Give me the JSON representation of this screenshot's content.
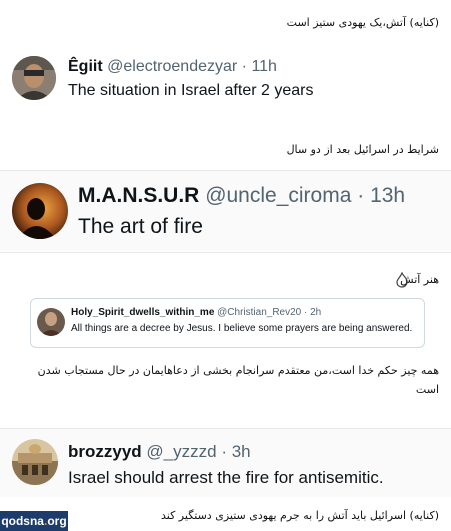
{
  "captions": {
    "c1": "(کنایه) آتش،یک یهودی ستیز است",
    "c2": "شرایط در اسرائیل بعد از دو سال",
    "c3": "هنر آتش",
    "c4": "همه چیز حکم خدا است،من معتقدم سرانجام بخشی از دعاهایمان در حال مستجاب شدن است",
    "c5": "(کنایه) اسرائیل باید آتش را به جرم یهودی ستیزی دستگیر کند"
  },
  "tweets": [
    {
      "name": "Êgiit",
      "handle": "@electroendezyar",
      "time": "· 11h",
      "text": "The situation in Israel after 2 years"
    },
    {
      "name": "M.A.N.S.U.R",
      "handle": "@uncle_ciroma",
      "time": "· 13h",
      "text": "The art of fire"
    },
    {
      "name": "brozzyyd",
      "handle": "@_yzzzd",
      "time": "· 3h",
      "text": "Israel should arrest the fire for antisemitic."
    }
  ],
  "quote": {
    "name": "Holy_Spirit_dwells_within_me",
    "handle": "@Christian_Rev20",
    "time": "· 2h",
    "text": "All things are a decree by Jesus. I believe some prayers are being answered."
  },
  "watermark": {
    "logo_text": "qodsna",
    "logo_dot": ".",
    "logo_tld": "org"
  },
  "colors": {
    "name": "#0f1419",
    "meta": "#536471",
    "logo_bg": "#1d3b6b",
    "logo_accent": "#ff8a1c"
  }
}
